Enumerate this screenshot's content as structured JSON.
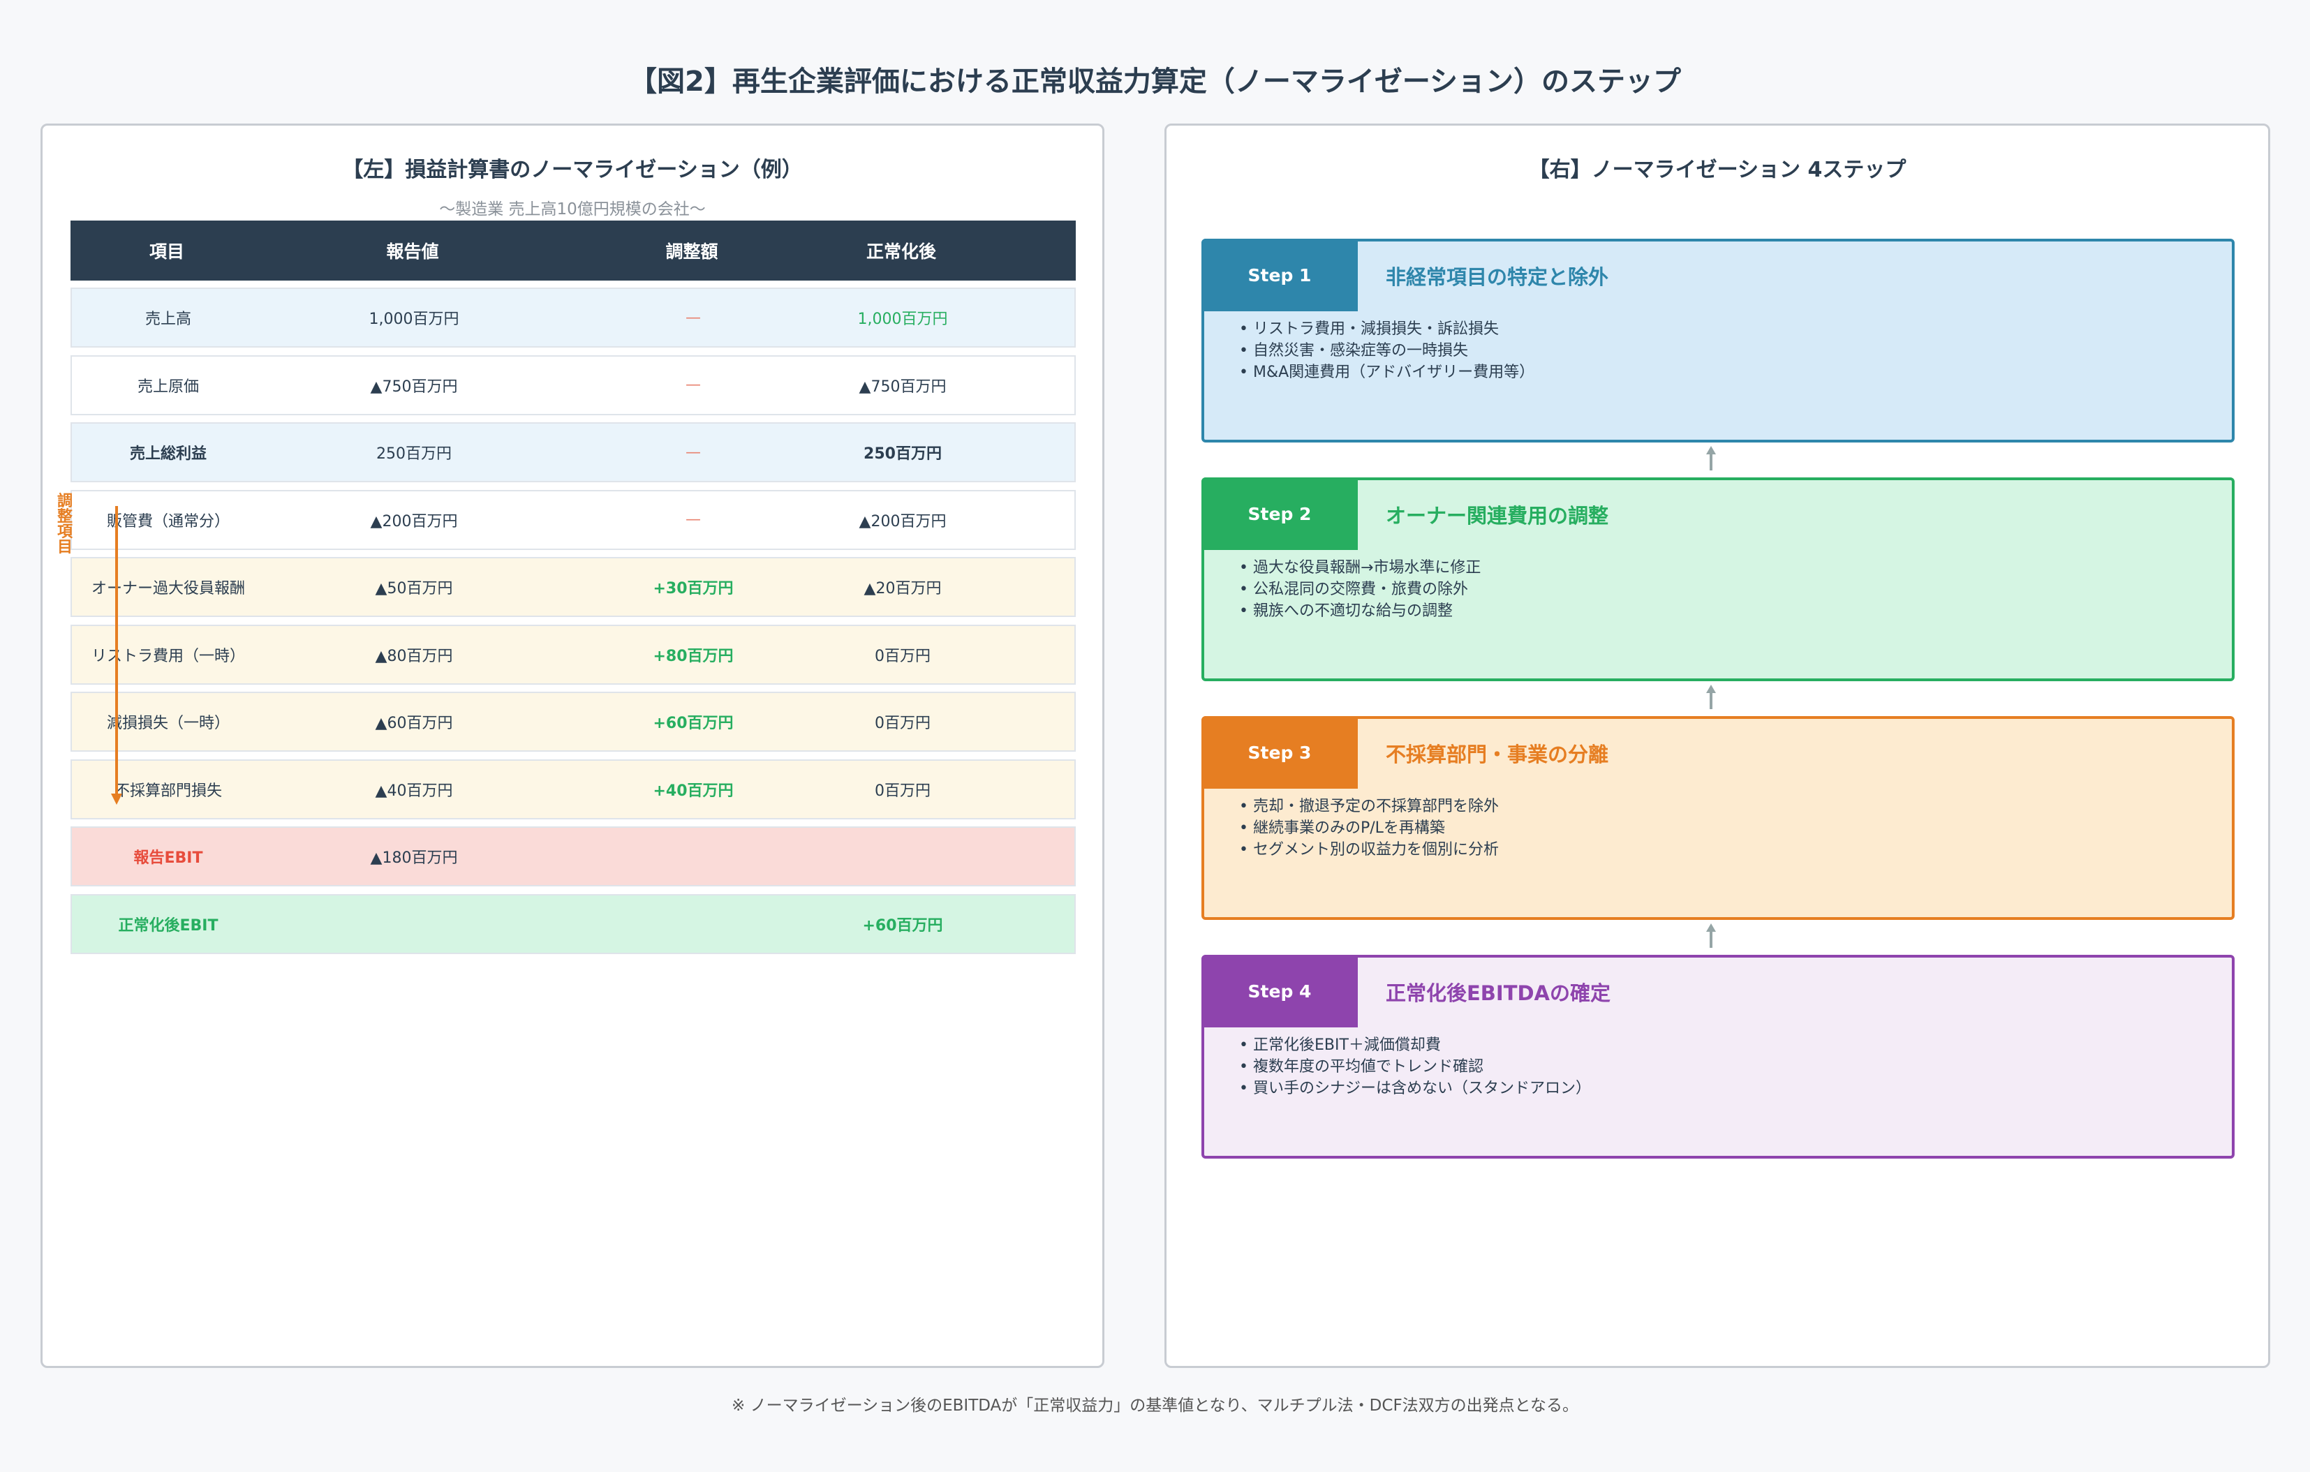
{
  "title": "【図2】再生企業評価における正常収益力算定（ノーマライゼーション）のステップ",
  "left": {
    "title": "【左】損益計算書のノーマライゼーション（例）",
    "subtitle": "〜製造業 売上高10億円規模の会社〜",
    "headers": [
      "項目",
      "報告値",
      "調整額",
      "正常化後"
    ],
    "side_label": "調整項目",
    "rows": [
      {
        "item": "売上高",
        "reported": "1,000百万円",
        "adjust": "—",
        "normalized": "1,000百万円",
        "style": "blue"
      },
      {
        "item": "売上原価",
        "reported": "▲750百万円",
        "adjust": "—",
        "normalized": "▲750百万円",
        "style": "white"
      },
      {
        "item": "売上総利益",
        "reported": "250百万円",
        "adjust": "—",
        "normalized": "250百万円",
        "style": "blue"
      },
      {
        "item": "販管費（通常分）",
        "reported": "▲200百万円",
        "adjust": "—",
        "normalized": "▲200百万円",
        "style": "white"
      },
      {
        "item": "オーナー過大役員報酬",
        "reported": "▲50百万円",
        "adjust": "+30百万円",
        "normalized": "▲20百万円",
        "style": "yellow"
      },
      {
        "item": "リストラ費用（一時）",
        "reported": "▲80百万円",
        "adjust": "+80百万円",
        "normalized": "0百万円",
        "style": "yellow"
      },
      {
        "item": "減損損失（一時）",
        "reported": "▲60百万円",
        "adjust": "+60百万円",
        "normalized": "0百万円",
        "style": "yellow"
      },
      {
        "item": "不採算部門損失",
        "reported": "▲40百万円",
        "adjust": "+40百万円",
        "normalized": "0百万円",
        "style": "yellow"
      },
      {
        "item": "報告EBIT",
        "reported": "▲180百万円",
        "adjust": "",
        "normalized": "",
        "style": "red"
      },
      {
        "item": "正常化後EBIT",
        "reported": "",
        "adjust": "",
        "normalized": "+60百万円",
        "style": "green"
      }
    ]
  },
  "right": {
    "title": "【右】ノーマライゼーション 4ステップ",
    "steps": [
      {
        "label": "Step 1",
        "title": "非経常項目の特定と除外",
        "color": "#2e86ab",
        "bg": "#d6eaf8",
        "bullets": [
          "リストラ費用・減損損失・訴訟損失",
          "自然災害・感染症等の一時損失",
          "M&A関連費用（アドバイザリー費用等）"
        ]
      },
      {
        "label": "Step 2",
        "title": "オーナー関連費用の調整",
        "color": "#27ae60",
        "bg": "#d5f5e3",
        "bullets": [
          "過大な役員報酬→市場水準に修正",
          "公私混同の交際費・旅費の除外",
          "親族への不適切な給与の調整"
        ]
      },
      {
        "label": "Step 3",
        "title": "不採算部門・事業の分離",
        "color": "#e67e22",
        "bg": "#fdebd0",
        "bullets": [
          "売却・撤退予定の不採算部門を除外",
          "継続事業のみのP/Lを再構築",
          "セグメント別の収益力を個別に分析"
        ]
      },
      {
        "label": "Step 4",
        "title": "正常化後EBITDAの確定",
        "color": "#8e44ad",
        "bg": "#f4ecf7",
        "bullets": [
          "正常化後EBIT＋減価償却費",
          "複数年度の平均値でトレンド確認",
          "買い手のシナジーは含めない（スタンドアロン）"
        ]
      }
    ]
  },
  "footnote": "※ ノーマライゼーション後のEBITDAが「正常収益力」の基準値となり、マルチプル法・DCF法双方の出発点となる。"
}
